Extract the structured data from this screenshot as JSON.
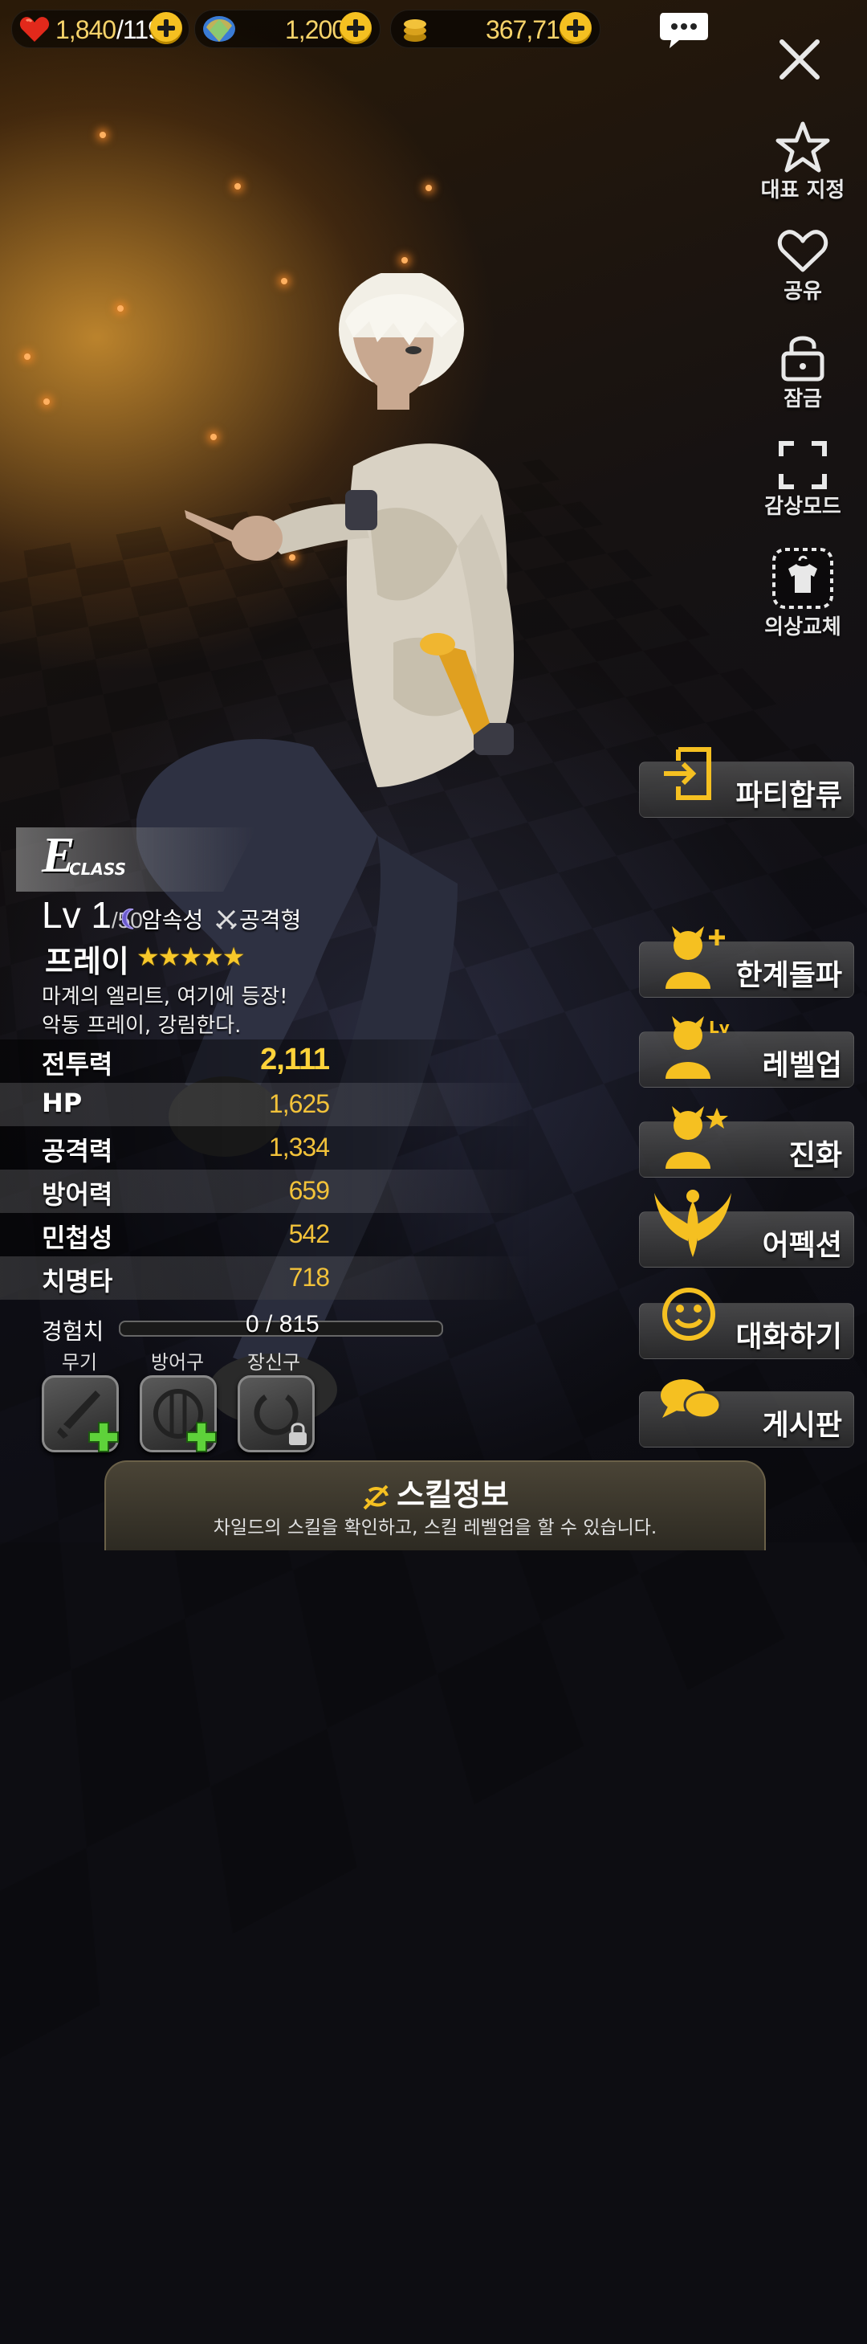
{
  "resources": {
    "stamina": {
      "value": "1,840",
      "max": "/119"
    },
    "gems": {
      "value": "1,200"
    },
    "gold": {
      "value": "367,716"
    }
  },
  "side_menu": [
    {
      "label": "대표 지정",
      "icon": "star-outline-icon"
    },
    {
      "label": "공유",
      "icon": "heart-outline-icon"
    },
    {
      "label": "잠금",
      "icon": "lock-open-icon"
    },
    {
      "label": "감상모드",
      "icon": "fullscreen-icon"
    },
    {
      "label": "의상교체",
      "icon": "costume-icon"
    }
  ],
  "actions": {
    "party": "파티합류",
    "limit_break": "한계돌파",
    "level_up": "레벨업",
    "evolve": "진화",
    "affection": "어펙션",
    "talk": "대화하기",
    "board": "게시판",
    "level_badge": "Lv"
  },
  "character": {
    "class_letter": "E",
    "class_word": "CLASS",
    "level": "Lv 1",
    "level_max": "/50",
    "element": "암속성",
    "type": "공격형",
    "name": "프레이",
    "stars": "★★★★★",
    "star_count": 5,
    "desc_line1": "마계의 엘리트, 여기에 등장!",
    "desc_line2": "악동 프레이, 강림한다."
  },
  "stats": [
    {
      "label": "전투력",
      "value": "2,111"
    },
    {
      "label": "HP",
      "value": "1,625"
    },
    {
      "label": "공격력",
      "value": "1,334"
    },
    {
      "label": "방어력",
      "value": "659"
    },
    {
      "label": "민첩성",
      "value": "542"
    },
    {
      "label": "치명타",
      "value": "718"
    }
  ],
  "exp": {
    "label": "경험치",
    "value": "0 / 815",
    "progress": 0
  },
  "equipment": {
    "weapon": "무기",
    "armor": "방어구",
    "accessory": "장신구"
  },
  "skill": {
    "title": "스킬정보",
    "subtitle": "차일드의 스킬을 확인하고, 스킬 레벨업을 할 수 있습니다."
  },
  "colors": {
    "accent": "#f5c021",
    "stat_value": "#f2c23a"
  }
}
